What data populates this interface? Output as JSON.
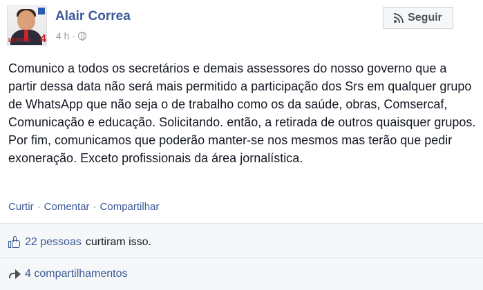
{
  "post": {
    "author": "Alair Correa",
    "time": "4 h",
    "meta_sep": "·",
    "avatar_brand": "LOTADO",
    "avatar_number": "4",
    "follow_label": "Seguir",
    "body": "Comunico a todos os secretários e demais assessores do nosso governo que a partir dessa data não será mais permitido a participação dos Srs em qualquer grupo de WhatsApp que não seja o de trabalho como os da saúde, obras, Comsercaf, Comunicação e educação. Solicitando. então, a retirada de outros quaisquer grupos. Por fim, comunicamos que poderão manter-se nos mesmos mas terão que pedir exoneração. Exceto profissionais da área jornalística.",
    "actions": {
      "like": "Curtir",
      "comment": "Comentar",
      "share": "Compartilhar",
      "sep": "·"
    }
  },
  "footer": {
    "likes_count": "22 pessoas",
    "likes_text": "curtiram isso.",
    "shares_text": "4 compartilhamentos"
  },
  "icons": {
    "follow": "rss-icon",
    "privacy": "globe-icon",
    "like": "thumbs-up-icon",
    "share": "share-arrow-icon"
  },
  "colors": {
    "link": "#3b5998",
    "meta": "#90949c",
    "footer_bg": "#f6f7f9",
    "brand_red": "#d0121b"
  }
}
